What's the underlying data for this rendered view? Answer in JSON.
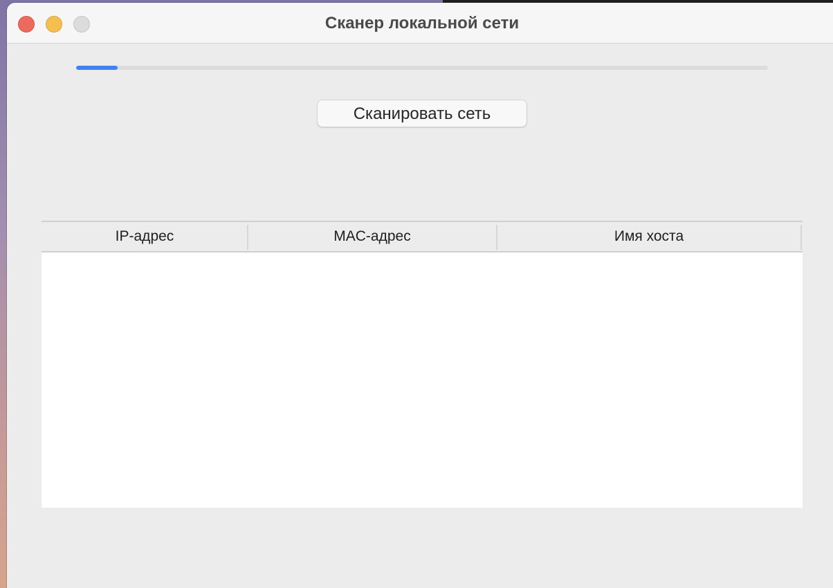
{
  "window": {
    "title": "Сканер локальной сети"
  },
  "progress": {
    "value_percent": 6,
    "color": "#3f82f0"
  },
  "scan_button": {
    "label": "Сканировать сеть"
  },
  "table": {
    "columns": [
      "IP-адрес",
      "MAC-адрес",
      "Имя хоста"
    ],
    "rows": []
  }
}
